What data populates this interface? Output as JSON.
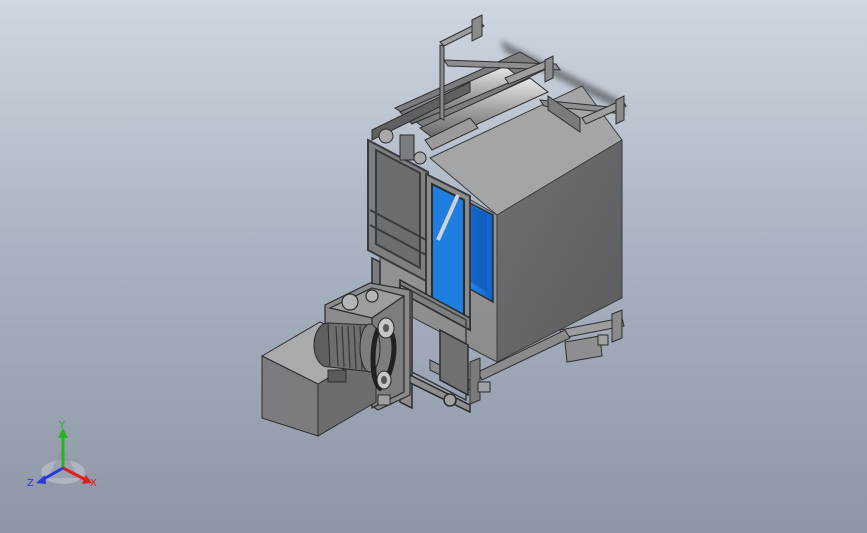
{
  "viewport": {
    "background_top": "#cfd6e0",
    "background_bottom": "#8c96a4"
  },
  "model": {
    "steel_color": "#8e8f90",
    "dark_steel": "#4a4b4c",
    "glass_color": "#1e7fe0",
    "motor_color": "#6d6e6f"
  },
  "triad": {
    "x_label": "X",
    "y_label": "Y",
    "z_label": "Z",
    "x_color": "#e01f1f",
    "y_color": "#25b325",
    "z_color": "#2a3ad8"
  }
}
